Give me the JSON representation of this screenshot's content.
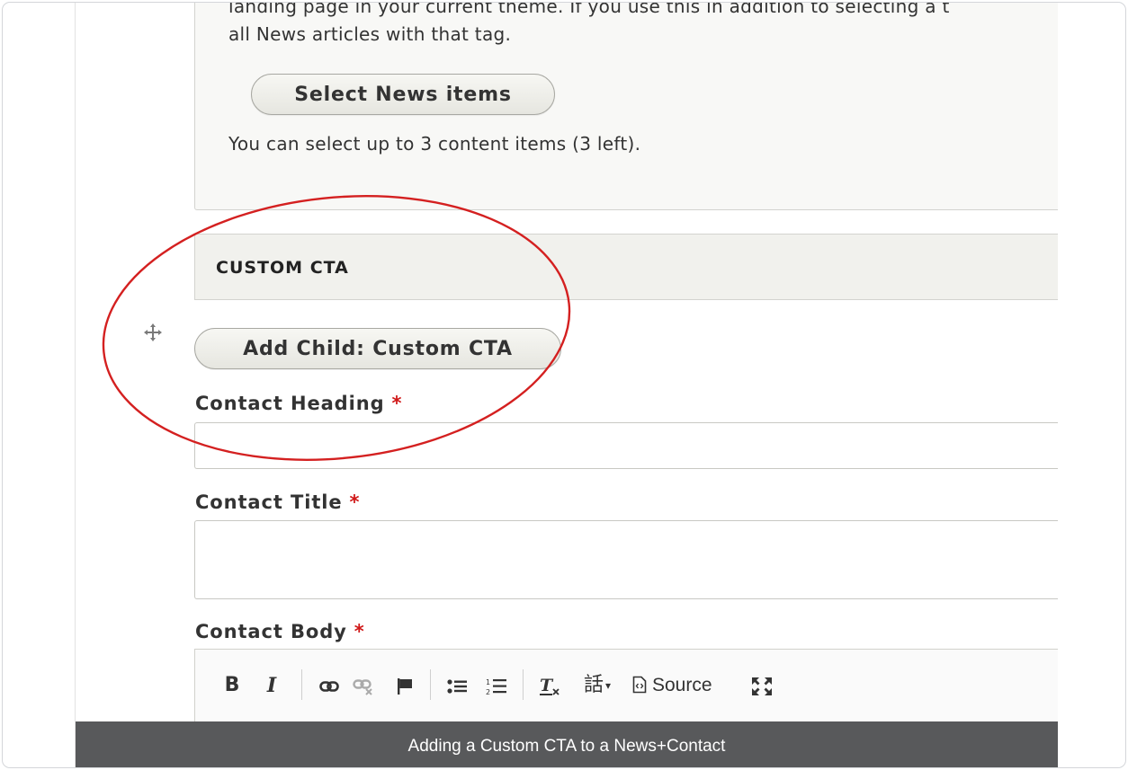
{
  "news_section": {
    "help_text_line1": "landing page in your current theme. If you use this in addition to selecting a t",
    "help_text_line2": "all News articles with that tag.",
    "select_button_label": "Select News items",
    "selection_note": "You can select up to 3 content items (3 left)."
  },
  "custom_cta": {
    "header": "CUSTOM CTA",
    "add_child_label": "Add Child: Custom CTA",
    "drag_icon": "move-arrows-icon"
  },
  "fields": {
    "contact_heading_label": "Contact Heading",
    "contact_title_label": "Contact Title",
    "contact_body_label": "Contact Body",
    "required_marker": "*",
    "contact_heading_value": "",
    "contact_title_value": ""
  },
  "editor_toolbar": {
    "bold": "B",
    "italic": "I",
    "link_icon": "link-icon",
    "unlink_icon": "unlink-icon",
    "anchor_icon": "flag-icon",
    "bulleted_list_icon": "bulleted-list-icon",
    "numbered_list_icon": "numbered-list-icon",
    "remove_format_icon": "remove-format-icon",
    "language_icon": "language-icon",
    "source_label": "Source",
    "maximize_icon": "maximize-icon"
  },
  "caption": "Adding a Custom CTA to a News+Contact",
  "colors": {
    "annotation_circle": "#d42020",
    "required": "#d01818",
    "caption_bg": "#58595b"
  }
}
